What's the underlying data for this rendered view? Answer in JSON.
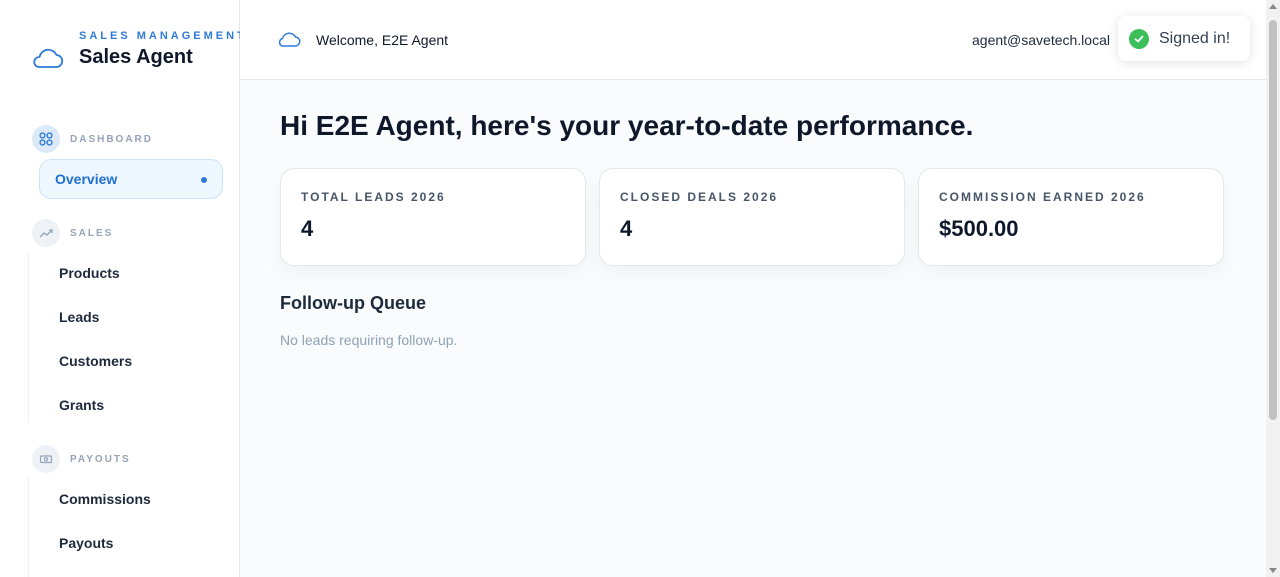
{
  "brand": {
    "subtitle": "SALES MANAGEMENT",
    "title": "Sales Agent",
    "icon": "cloud-icon"
  },
  "sidebar": {
    "sections": [
      {
        "label": "DASHBOARD",
        "icon": "grid-icon",
        "items": [
          {
            "label": "Overview",
            "active": true
          }
        ]
      },
      {
        "label": "SALES",
        "icon": "trend-icon",
        "items": [
          {
            "label": "Products"
          },
          {
            "label": "Leads"
          },
          {
            "label": "Customers"
          },
          {
            "label": "Grants"
          }
        ]
      },
      {
        "label": "PAYOUTS",
        "icon": "cash-icon",
        "items": [
          {
            "label": "Commissions"
          },
          {
            "label": "Payouts"
          }
        ]
      }
    ]
  },
  "topbar": {
    "welcome": "Welcome, E2E Agent",
    "email": "agent@savetech.local"
  },
  "toast": {
    "message": "Signed in!"
  },
  "main": {
    "heading": "Hi E2E Agent, here's your year-to-date performance.",
    "stats": [
      {
        "label": "TOTAL LEADS 2026",
        "value": "4"
      },
      {
        "label": "CLOSED DEALS 2026",
        "value": "4"
      },
      {
        "label": "COMMISSION EARNED 2026",
        "value": "$500.00"
      }
    ],
    "followup": {
      "title": "Follow-up Queue",
      "empty": "No leads requiring follow-up."
    }
  },
  "colors": {
    "accent": "#2f7bd8",
    "active_bg": "#eef6fe",
    "success": "#3cbf5a"
  }
}
